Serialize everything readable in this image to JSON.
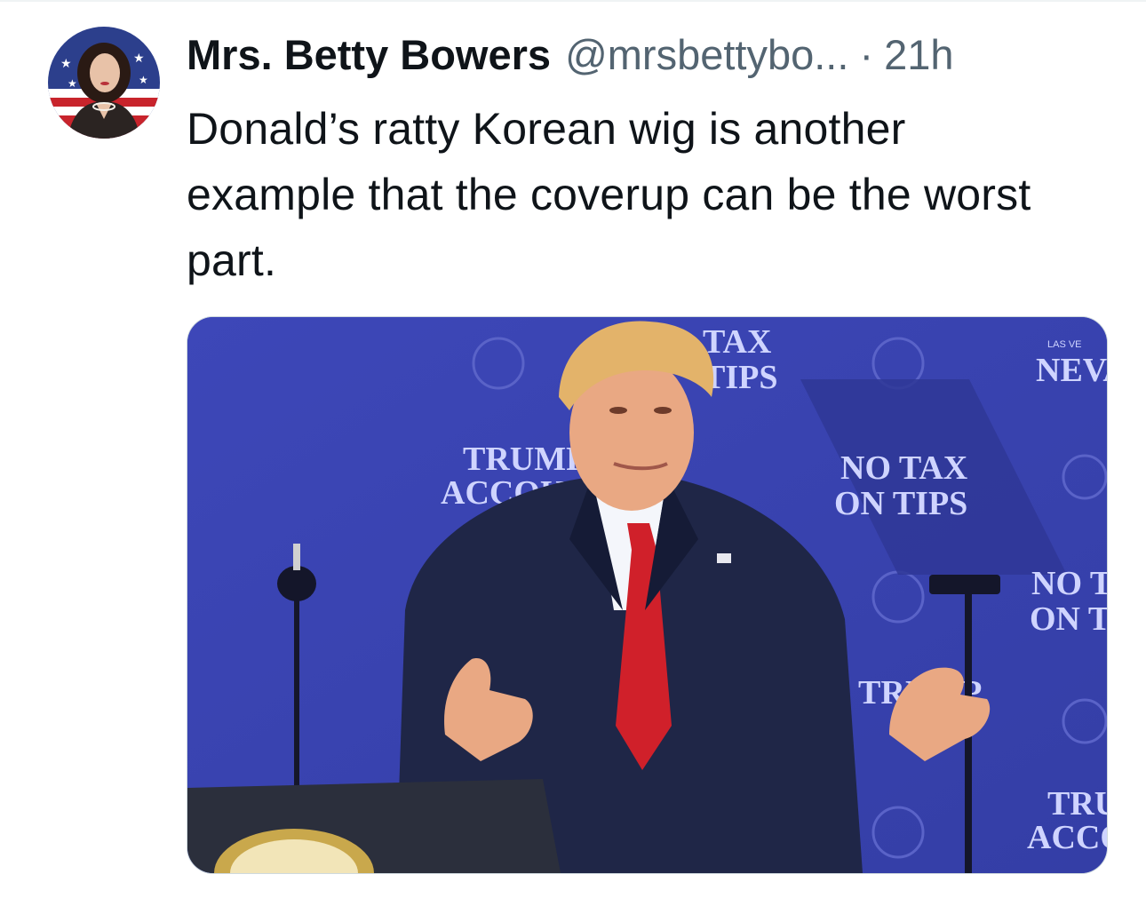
{
  "tweet": {
    "author": {
      "display_name": "Mrs. Betty Bowers",
      "handle": "@mrsbettybo...",
      "avatar_icon": "avatar-icon"
    },
    "separator": "·",
    "time": "21h",
    "text": "Donald’s ratty Korean wig is another example that the coverup can be the worst part.",
    "media": {
      "signs": [
        {
          "line1": "TAX",
          "line2": "TIPS"
        },
        {
          "line1": "TRUMP",
          "line2": "ACCOUNTS"
        },
        {
          "line1": "NO TAX",
          "line2": "ON TIPS"
        },
        {
          "line1": "NEVA"
        },
        {
          "line1": "NO T",
          "line2": "ON T"
        },
        {
          "line1": "TRUMP"
        },
        {
          "line1": "TRU",
          "line2": "ACCOU"
        },
        {
          "line1": "LAS VE"
        }
      ]
    }
  },
  "colors": {
    "backdrop": "#3b44b3",
    "suit": "#1c2340",
    "tie": "#d0202a",
    "text_primary": "#0f1419",
    "text_secondary": "#536471"
  }
}
